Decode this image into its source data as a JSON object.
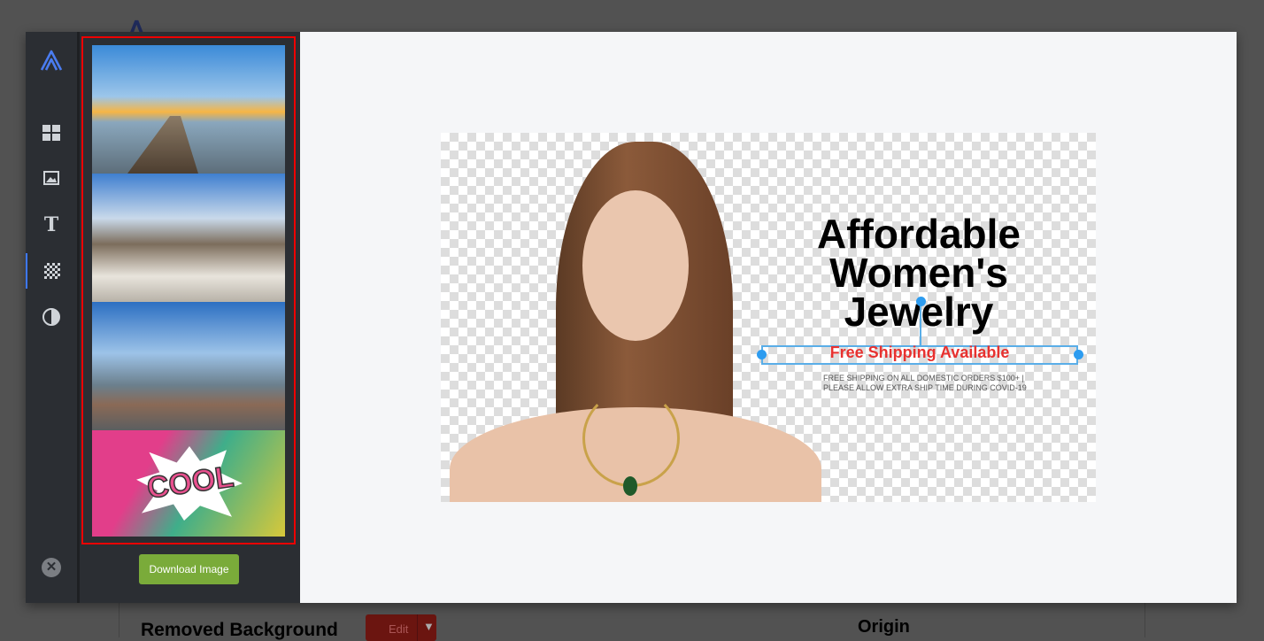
{
  "background": {
    "section_title": "Removed Background",
    "edit_label": "Edit",
    "origin_title": "Origin"
  },
  "rail": {
    "items": [
      {
        "name": "templates"
      },
      {
        "name": "image"
      },
      {
        "name": "text"
      },
      {
        "name": "background",
        "active": true
      },
      {
        "name": "adjust"
      }
    ]
  },
  "panel": {
    "thumbnails": [
      "sunset pier",
      "city crowd",
      "skyscrapers",
      "cool comic"
    ],
    "download_label": "Download Image"
  },
  "design": {
    "headline": "Affordable Women's Jewelry",
    "tagline": "Free Shipping Available",
    "fine_print_1": "FREE SHIPPING ON ALL DOMESTIC ORDERS $100+  |",
    "fine_print_2": "PLEASE ALLOW EXTRA SHIP TIME DURING COVID-19"
  },
  "colors": {
    "accent": "#3d78ff",
    "download": "#7aab3a",
    "tagline": "#e8312f",
    "selection": "#2d9cf0"
  }
}
